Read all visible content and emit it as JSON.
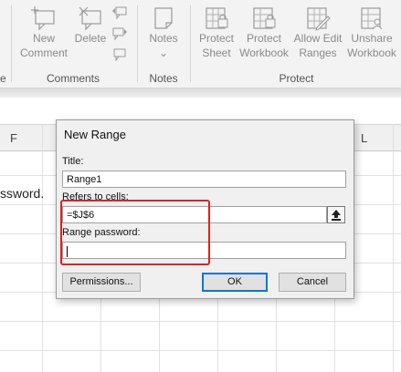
{
  "ribbon": {
    "groups": {
      "comments": "Comments",
      "notes": "Notes",
      "protect": "Protect",
      "edge_fragment": "e"
    },
    "buttons": {
      "new_comment": [
        "New",
        "Comment"
      ],
      "delete": "Delete",
      "notes": "Notes",
      "notes_chevron": "⌄",
      "protect_sheet": [
        "Protect",
        "Sheet"
      ],
      "protect_workbook": [
        "Protect",
        "Workbook"
      ],
      "allow_edit_ranges": [
        "Allow Edit",
        "Ranges"
      ],
      "unshare_workbook": [
        "Unshare",
        "Workbook"
      ]
    }
  },
  "sheet": {
    "columns": [
      "F",
      "L"
    ],
    "cell_text": "ssword."
  },
  "dialog": {
    "title": "New Range",
    "title_label": "Title:",
    "title_value": "Range1",
    "refers_label": "Refers to cells:",
    "refers_value": "=$J$6",
    "password_label": "Range password:",
    "password_value": "",
    "permissions_button": "Permissions...",
    "ok_button": "OK",
    "cancel_button": "Cancel"
  },
  "colors": {
    "highlight": "#e02020",
    "default_button_border": "#0078d7"
  }
}
